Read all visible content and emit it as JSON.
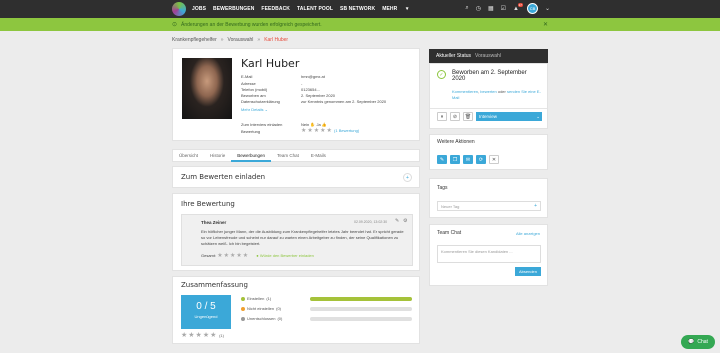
{
  "nav": {
    "items": [
      "JOBS",
      "BEWERBUNGEN",
      "FEEDBACK",
      "TALENT POOL",
      "SB NETWORK",
      "MEHR"
    ],
    "avatar_initials": "CB",
    "notif_count": "17"
  },
  "alert": {
    "message": "Änderungen an der Bewerbung wurden erfolgreich gespeichert."
  },
  "breadcrumb": [
    "Krankenpflegehelfer",
    "Vorauswahl",
    "Karl Huber"
  ],
  "candidate": {
    "name": "Karl Huber",
    "labels": [
      "E-Mail",
      "Adresse",
      "Telefon (mobil)",
      "Beworben am",
      "Datenschutzerklärung"
    ],
    "values": [
      "hmn@gmx.at",
      "-",
      "0123654...",
      "2. September 2020",
      "zur Kenntnis genommen am 2. September 2020"
    ],
    "more_details": "Mehr Details",
    "interview_label": "Zum Interview einladen",
    "rating_label": "Bewertung",
    "nein": "Nein",
    "ja": "Ja",
    "rating_count": "(1 Bewertung)"
  },
  "tabs": [
    "Übersicht",
    "Historie",
    "Bewerbungen",
    "Team Chat",
    "E-Mails"
  ],
  "active_tab": "Bewerbungen",
  "invite": {
    "title": "Zum Bewerten einladen"
  },
  "review": {
    "title": "Ihre Bewertung",
    "author": "Thea Zeiner",
    "date": "02.09.2020, 13:02:30",
    "text": "Ein höflicher junger Mann, der die Ausbildung zum Krankenpflegehelfer letztes Jahr beendet hat. Er spricht gerade so vor Lebensfreude und scheint nur darauf zu warten einen Arbeitgeber zu finden, der seine Qualifikationen zu schätzen weiß. Ich bin begeistert.",
    "total_label": "Gesamt:",
    "hint": "Würde den Bewerber einladen"
  },
  "summary": {
    "title": "Zusammenfassung",
    "score": "0 / 5",
    "score_label": "Ungenügend",
    "count": "(1)",
    "rows": [
      {
        "label": "Einstellen",
        "count": "(1)",
        "color": "#a5c23a",
        "fill": 1.0
      },
      {
        "label": "Nicht einstellen",
        "count": "(0)",
        "color": "#f0a030",
        "fill": 0
      },
      {
        "label": "Unentschlossen",
        "count": "(0)",
        "color": "#999999",
        "fill": 0
      }
    ]
  },
  "status": {
    "header": "Aktueller Status",
    "header_sub": "Vorauswahl",
    "title_line1": "Beworben am 2. September",
    "title_line2": "2020",
    "desc_link1": "Kommentieren",
    "desc_sep": ",",
    "desc_link2": "bewerten",
    "desc_text": "oder",
    "desc_link3": "senden Sie eine E-Mail",
    "dropdown": "Interview"
  },
  "weitere": {
    "title": "Weitere Aktionen"
  },
  "tags_panel": {
    "title": "Tags",
    "placeholder": "Neuer Tag"
  },
  "chat_panel": {
    "title": "Team Chat",
    "link": "Alle anzeigen",
    "placeholder": "Kommentieren Sie diesen Kandidaten ...",
    "send": "Absenden"
  },
  "chat_button": "Chat",
  "colors": {
    "accent": "#3ba8d8",
    "success": "#8dc63f",
    "dark": "#2f2f2f"
  }
}
